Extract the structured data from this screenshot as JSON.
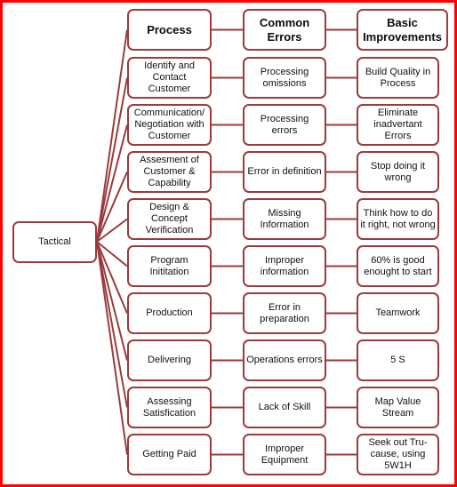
{
  "diagram": {
    "root": {
      "label": "Tactical"
    },
    "colors": {
      "frame": "#ff0000",
      "box_border": "#9b3b3b",
      "connector": "#9b3b3b"
    },
    "headers": [
      "Process",
      "Common Errors",
      "Basic Improvements"
    ],
    "rows": [
      {
        "process": "Identify and Contact Customer",
        "error": "Processing omissions",
        "improvement": "Build Quality in Process"
      },
      {
        "process": "Communication/ Negotiation with Customer",
        "error": "Processing errors",
        "improvement": "Eliminate inadvertant Errors"
      },
      {
        "process": "Assesment of Customer & Capability",
        "error": "Error in definition",
        "improvement": "Stop doing it wrong"
      },
      {
        "process": "Design & Concept Verification",
        "error": "Missing Information",
        "improvement": "Think how to do it right, not wrong"
      },
      {
        "process": "Program Inititation",
        "error": "Improper information",
        "improvement": "60% is good enought to start"
      },
      {
        "process": "Production",
        "error": "Error in preparation",
        "improvement": "Teamwork"
      },
      {
        "process": "Delivering",
        "error": "Operations errors",
        "improvement": "5 S"
      },
      {
        "process": "Assessing Satisfication",
        "error": "Lack of Skill",
        "improvement": "Map Value Stream"
      },
      {
        "process": "Getting Paid",
        "error": "Improper Equipment",
        "improvement": "Seek out Tru-cause, using 5W1H"
      }
    ]
  }
}
